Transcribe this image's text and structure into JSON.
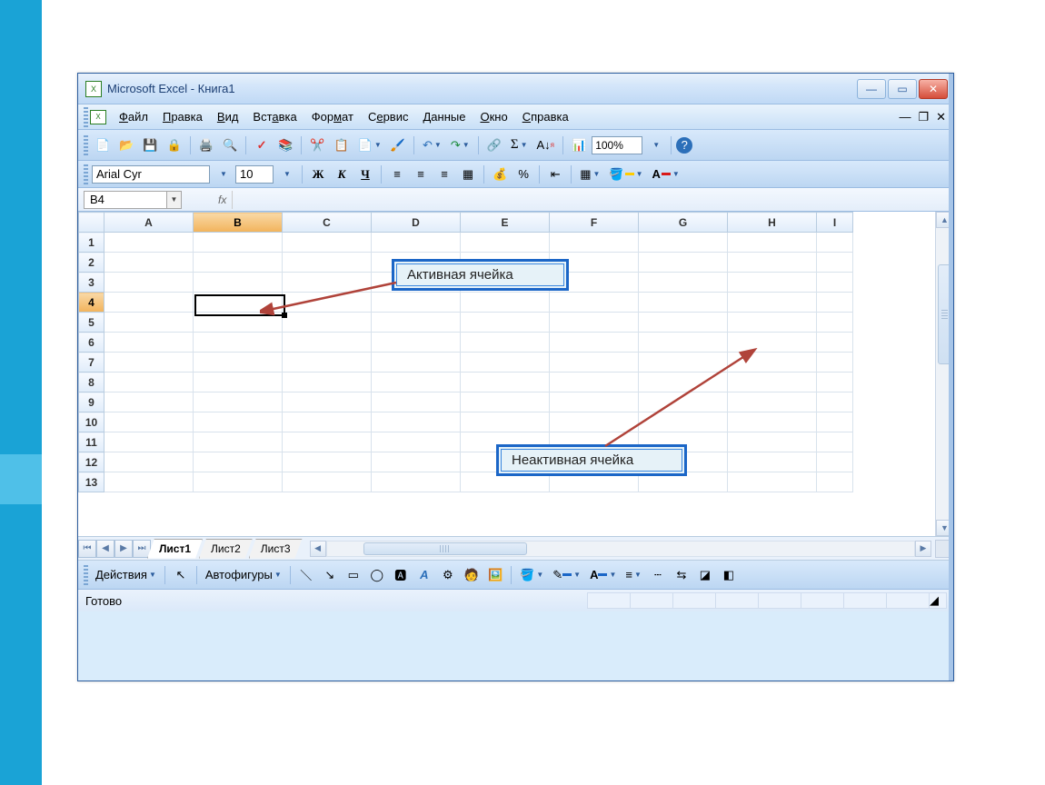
{
  "titlebar": {
    "title": "Microsoft Excel - Книга1"
  },
  "menu": {
    "items": [
      "Файл",
      "Правка",
      "Вид",
      "Вставка",
      "Формат",
      "Сервис",
      "Данные",
      "Окно",
      "Справка"
    ]
  },
  "toolbar": {
    "zoom": "100%"
  },
  "format": {
    "font": "Arial Cyr",
    "size": "10",
    "bold": "Ж",
    "italic": "К",
    "underline": "Ч",
    "percent": "%"
  },
  "formula": {
    "cell_ref": "B4",
    "fx": "fx"
  },
  "grid": {
    "columns": [
      "A",
      "B",
      "C",
      "D",
      "E",
      "F",
      "G",
      "H",
      "I"
    ],
    "rows": [
      "1",
      "2",
      "3",
      "4",
      "5",
      "6",
      "7",
      "8",
      "9",
      "10",
      "11",
      "12",
      "13"
    ],
    "active_col": "B",
    "active_row": "4"
  },
  "sheets": {
    "tabs": [
      "Лист1",
      "Лист2",
      "Лист3"
    ],
    "active": 0
  },
  "drawing": {
    "actions": "Действия",
    "autoshapes": "Автофигуры"
  },
  "status": {
    "ready": "Готово"
  },
  "callouts": {
    "active_cell": "Активная ячейка",
    "inactive_cell": "Неактивная ячейка"
  }
}
